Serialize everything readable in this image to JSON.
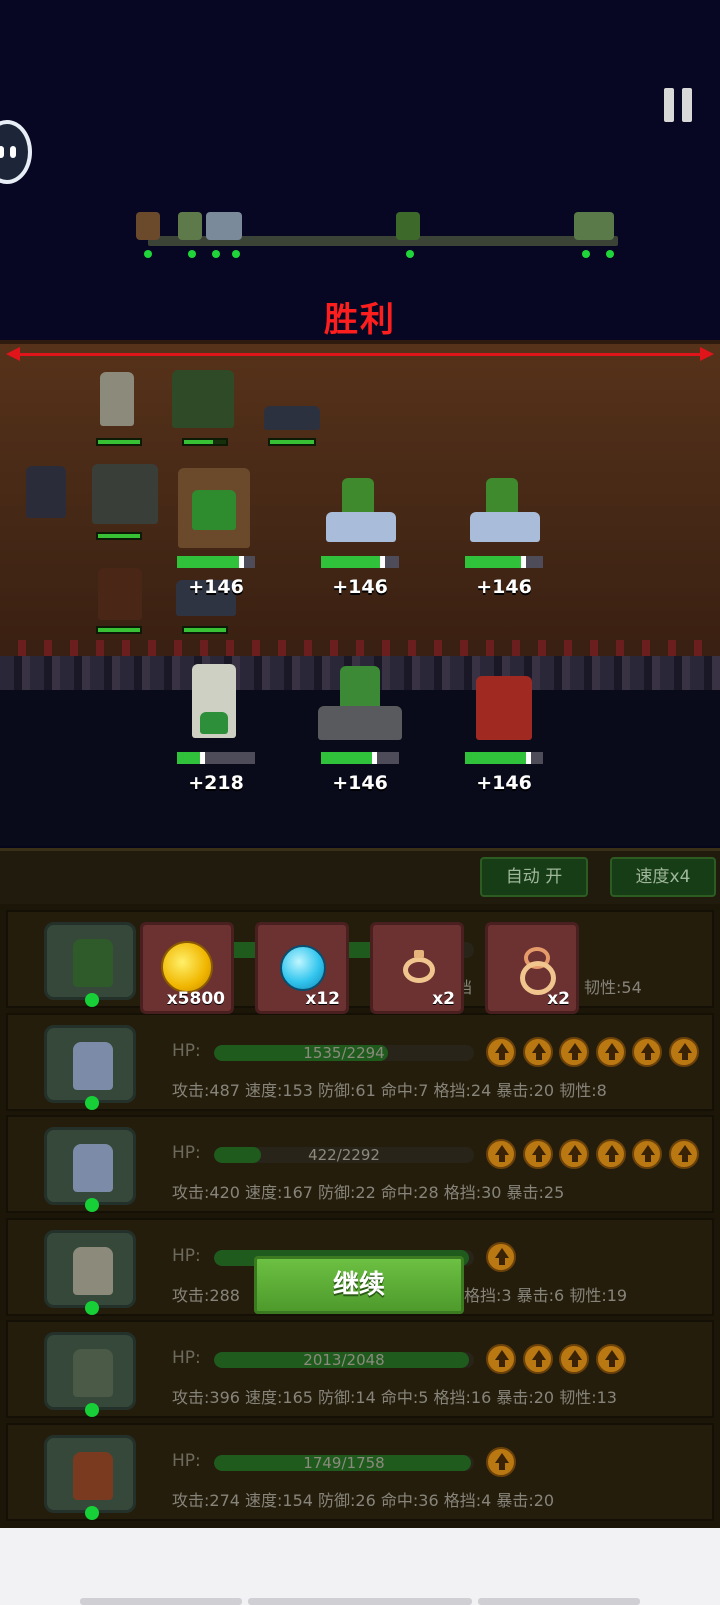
{
  "battle": {
    "result_text": "胜利",
    "heal_numbers": {
      "enemy_1": "+146",
      "enemy_2": "+146",
      "enemy_3": "+146",
      "ally_1": "+218",
      "ally_2": "+146",
      "ally_3": "+146"
    },
    "unit_hp_fraction": {
      "enemy_1": 0.8,
      "enemy_2": 0.75,
      "enemy_3": 0.72,
      "ally_1": 0.3,
      "ally_2": 0.65,
      "ally_3": 0.78
    }
  },
  "controls": {
    "auto_label": "自动 开",
    "speed_label": "速度x4"
  },
  "rewards": [
    {
      "icon": "gold-coin-icon",
      "count": "x5800"
    },
    {
      "icon": "blue-gem-icon",
      "count": "x12"
    },
    {
      "icon": "ring-icon",
      "count": "x2"
    },
    {
      "icon": "amulet-icon",
      "count": "x2"
    }
  ],
  "roster": {
    "hp_label": "HP:",
    "rows": [
      {
        "hp_text": "",
        "hp_fraction": 0.95,
        "stats": "",
        "stats_tail": "挡",
        "stats_tail2": "韧性:54",
        "upgrades": 0
      },
      {
        "hp_text": "1535/2294",
        "hp_fraction": 0.67,
        "stats": "攻击:487 速度:153 防御:61 命中:7 格挡:24 暴击:20 韧性:8",
        "upgrades": 6
      },
      {
        "hp_text": "422/2292",
        "hp_fraction": 0.18,
        "stats": "攻击:420 速度:167 防御:22 命中:28 格挡:30 暴击:25",
        "upgrades": 6
      },
      {
        "hp_text": "",
        "hp_fraction": 0.98,
        "stats": "攻击:288",
        "stats_tail": "格挡:3 暴击:6 韧性:19",
        "upgrades": 1
      },
      {
        "hp_text": "2013/2048",
        "hp_fraction": 0.98,
        "stats": "攻击:396 速度:165 防御:14 命中:5 格挡:16 暴击:20 韧性:13",
        "upgrades": 4
      },
      {
        "hp_text": "1749/1758",
        "hp_fraction": 0.99,
        "stats": "攻击:274 速度:154 防御:26 命中:36 格挡:4 暴击:20",
        "upgrades": 1
      }
    ]
  },
  "continue_label": "继续",
  "colors": {
    "victory": "#ff1e1e",
    "hp_green": "#30c23b",
    "panel_bg": "#1b1608",
    "continue_green": "#5aad36"
  }
}
